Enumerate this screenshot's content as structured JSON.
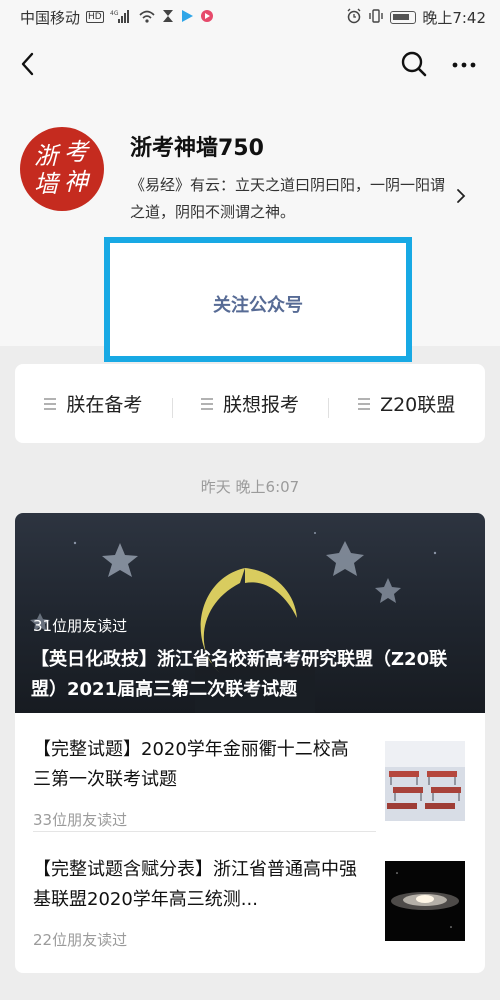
{
  "statusbar": {
    "carrier": "中国移动",
    "hd": "HD",
    "network": "4G",
    "time": "晚上7:42"
  },
  "icons": {
    "back": "chevron-left-icon",
    "search": "search-icon",
    "more": "more-icon"
  },
  "account": {
    "avatar_text": [
      "浙",
      "考",
      "墙",
      "神"
    ],
    "name": "浙考神墙750",
    "description": "《易经》有云：立天之道曰阴曰阳，一阴一阳谓之道，阴阳不测谓之神。"
  },
  "follow_label": "关注公众号",
  "menu": [
    {
      "label": "朕在备考"
    },
    {
      "label": "朕想报考"
    },
    {
      "label": "Z20联盟"
    }
  ],
  "feed": {
    "timestamp": "昨天 晚上6:07",
    "main_article": {
      "reads": "31位朋友读过",
      "title": "【英日化政技】浙江省名校新高考研究联盟（Z20联盟）2021届高三第二次联考试题"
    },
    "articles": [
      {
        "title": "【完整试题】2020学年金丽衢十二校高三第一次联考试题",
        "reads": "33位朋友读过"
      },
      {
        "title": "【完整试题含赋分表】浙江省普通高中强基联盟2020学年高三统测...",
        "reads": "22位朋友读过"
      }
    ]
  },
  "colors": {
    "accent_highlight": "#18a9e4",
    "follow_text": "#576b95",
    "avatar_bg": "#c52b1f",
    "background": "#ededed"
  }
}
